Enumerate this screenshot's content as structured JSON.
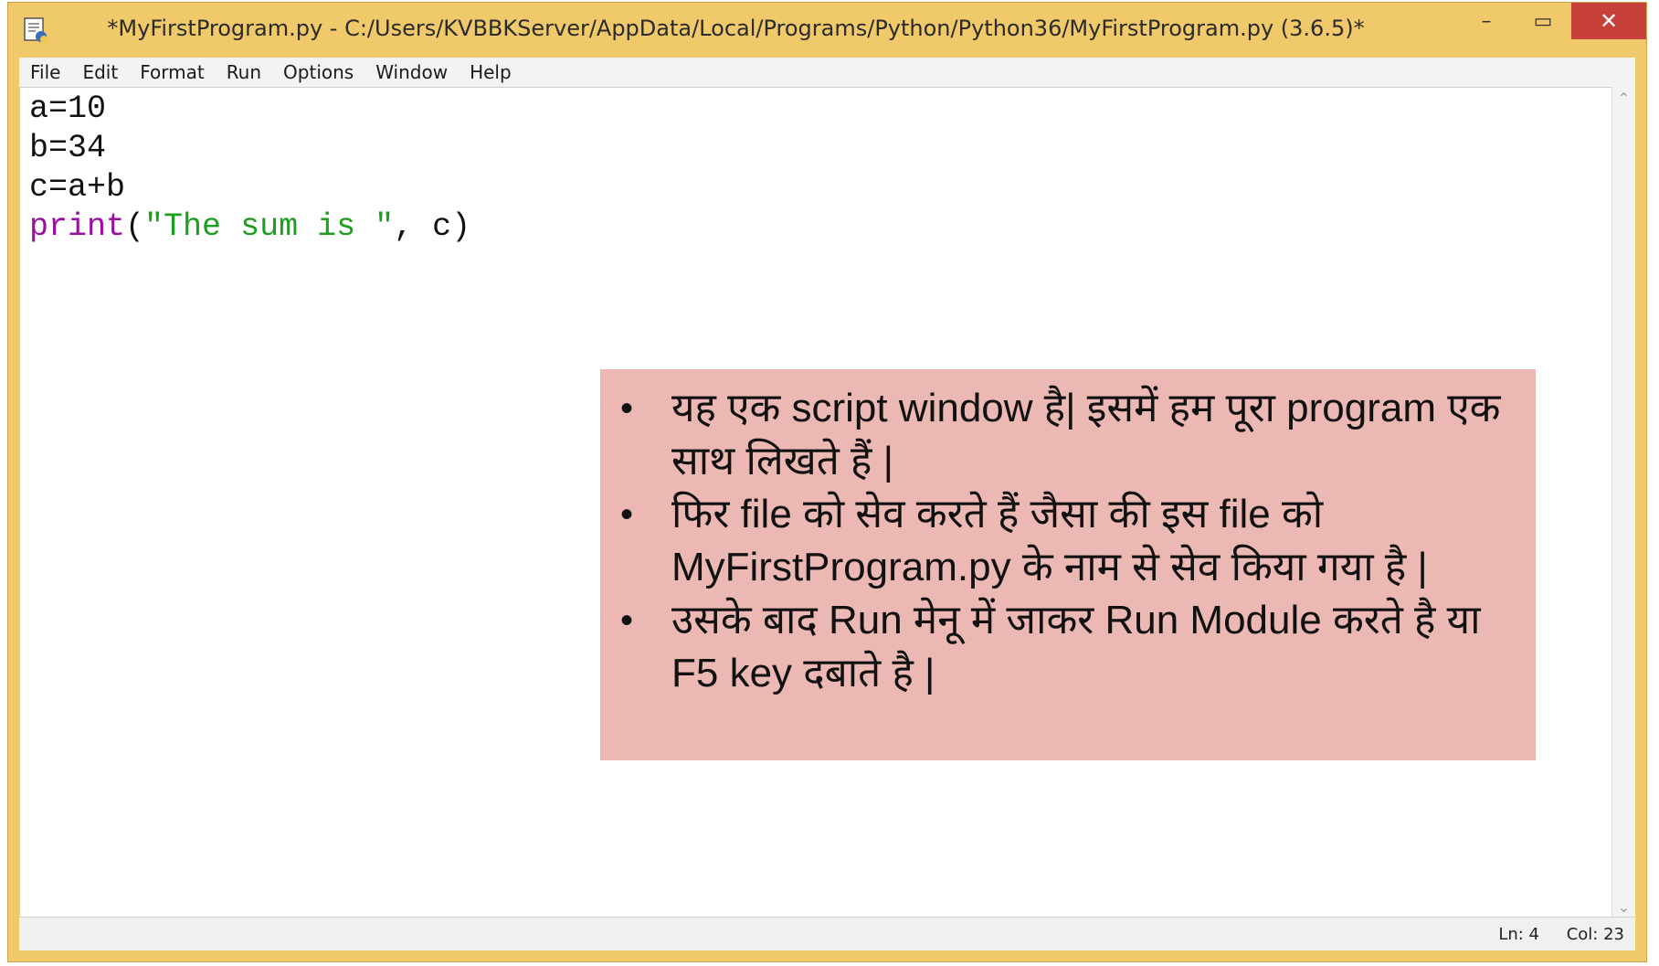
{
  "window": {
    "title": "*MyFirstProgram.py - C:/Users/KVBBKServer/AppData/Local/Programs/Python/Python36/MyFirstProgram.py (3.6.5)*",
    "app_icon": "python-idle-icon",
    "controls": {
      "minimize": "–",
      "maximize": "▭",
      "close": "✕"
    },
    "frame_color": "#f0c96a",
    "close_color": "#c7413a"
  },
  "menu": [
    "File",
    "Edit",
    "Format",
    "Run",
    "Options",
    "Window",
    "Help"
  ],
  "editor": {
    "lines": [
      {
        "plain": "a=10"
      },
      {
        "plain": "b=34"
      },
      {
        "plain": "c=a+b"
      },
      {
        "builtin": "print",
        "open": "(",
        "string": "\"The sum is \"",
        "rest": ", c)"
      }
    ],
    "colors": {
      "builtin": "#9a0ea1",
      "string": "#1e9e1e"
    }
  },
  "note": {
    "background": "#ecb8b3",
    "bullets": [
      "यह एक script window है| इसमें हम पूरा program एक साथ लिखते हैं |",
      "फिर file को सेव करते हैं जैसा की इस file को MyFirstProgram.py के नाम से सेव किया गया है |",
      "उसके बाद Run मेनू में जाकर Run Module करते है या F5 key दबाते है |"
    ]
  },
  "status": {
    "line": "Ln: 4",
    "col": "Col: 23"
  }
}
